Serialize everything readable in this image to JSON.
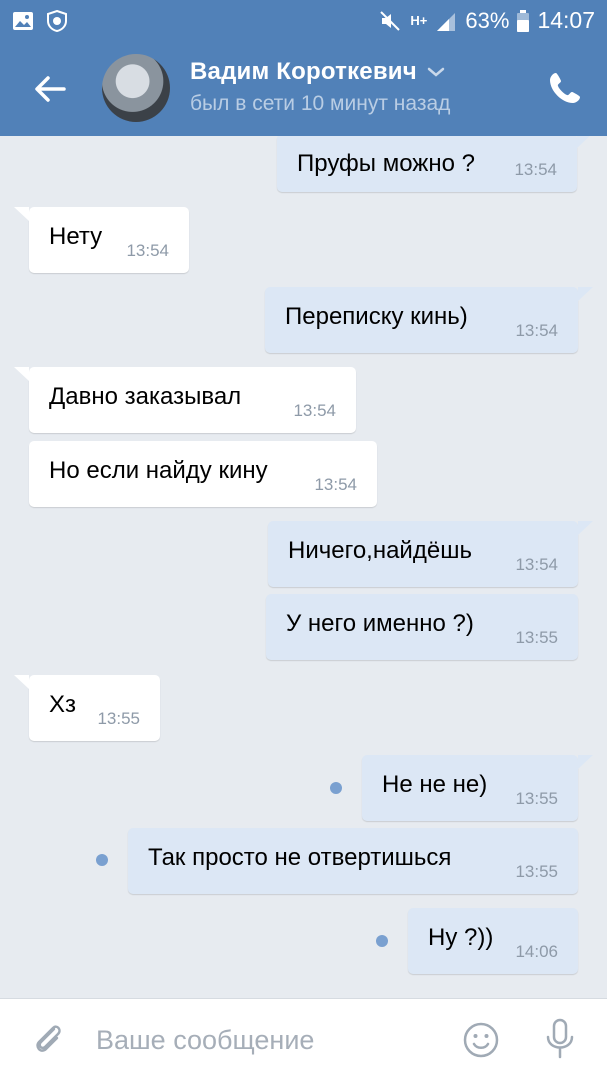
{
  "status_bar": {
    "network": "H+",
    "battery": "63%",
    "time": "14:07"
  },
  "header": {
    "name": "Вадим Короткевич",
    "status": "был в сети 10 минут назад"
  },
  "messages": [
    {
      "dir": "out",
      "text": "Пруфы можно ?",
      "time": "13:54"
    },
    {
      "dir": "in",
      "text": "Нету",
      "time": "13:54"
    },
    {
      "dir": "out",
      "text": "Переписку кинь)",
      "time": "13:54"
    },
    {
      "dir": "in",
      "text": "Давно заказывал",
      "time": "13:54"
    },
    {
      "dir": "in",
      "text": "Но если найду кину",
      "time": "13:54"
    },
    {
      "dir": "out",
      "text": "Ничего,найдёшь",
      "time": "13:54"
    },
    {
      "dir": "out",
      "text": "У него именно ?)",
      "time": "13:55"
    },
    {
      "dir": "in",
      "text": "Хз",
      "time": "13:55"
    },
    {
      "dir": "out",
      "text": "Не не не)",
      "time": "13:55",
      "unread": true
    },
    {
      "dir": "out",
      "text": "Так просто не отвертишься",
      "time": "13:55",
      "unread": true
    },
    {
      "dir": "out",
      "text": "Ну ?))",
      "time": "14:06",
      "unread": true
    }
  ],
  "composer": {
    "placeholder": "Ваше сообщение"
  },
  "colors": {
    "header": "#5181b8",
    "outgoing_bubble": "#dce7f5",
    "incoming_bubble": "#ffffff",
    "chat_background": "#e7ebf0"
  }
}
